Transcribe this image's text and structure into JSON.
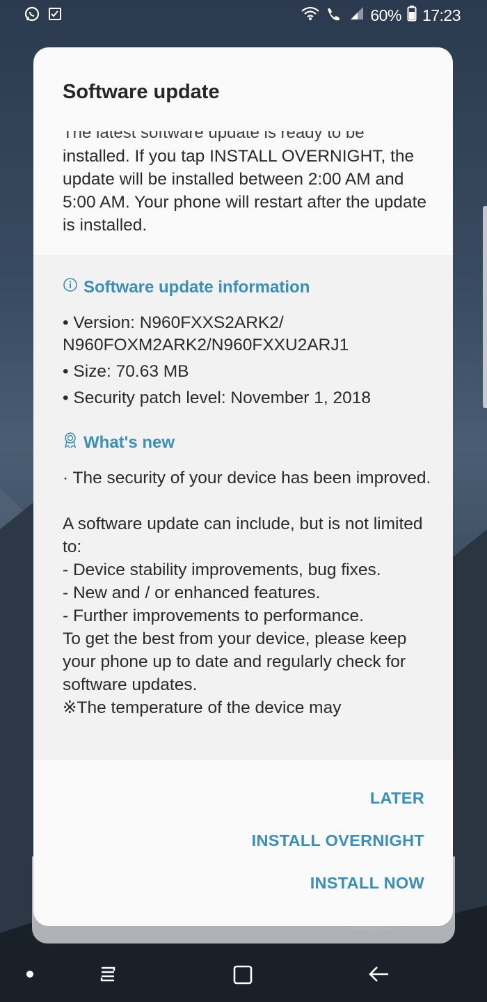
{
  "status_bar": {
    "battery": "60%",
    "time": "17:23",
    "left_icons": [
      "whatsapp-icon",
      "checkbox-notification-icon"
    ],
    "right_icons": [
      "wifi-icon",
      "wifi-calling-icon",
      "signal-icon",
      "battery-icon"
    ]
  },
  "dialog": {
    "title": "Software update",
    "intro_cut_line": "The latest software update is ready to be",
    "intro": "installed. If you tap INSTALL OVERNIGHT, the update will be installed between 2:00 AM and 5:00 AM. Your phone will restart after the update is installed.",
    "info_section": {
      "heading": "Software update information",
      "icon": "info-icon",
      "version": "• Version: N960FXXS2ARK2/ N960FOXM2ARK2/N960FXXU2ARJ1",
      "size": "• Size: 70.63 MB",
      "security_patch": "• Security patch level: November 1, 2018"
    },
    "whats_new": {
      "heading": "What's new",
      "icon": "badge-icon",
      "body": "· The security of your device has been improved.\n\nA software update can include, but is not limited to:\n - Device stability improvements, bug fixes.\n - New and / or enhanced features.\n - Further improvements to performance.\nTo get the best from your device, please keep your phone up to date and regularly check for software updates.\n※The temperature of the device may"
    },
    "buttons": {
      "later": "LATER",
      "install_overnight": "INSTALL OVERNIGHT",
      "install_now": "INSTALL NOW"
    }
  },
  "colors": {
    "accent": "#3a8fb9",
    "dialog_bg": "#fafafa",
    "panel_bg": "#f2f2f2",
    "text": "#2a2a2a"
  },
  "nav_bar": {
    "icons": [
      "nav-dot-icon",
      "recents-icon",
      "home-icon",
      "back-icon"
    ]
  }
}
